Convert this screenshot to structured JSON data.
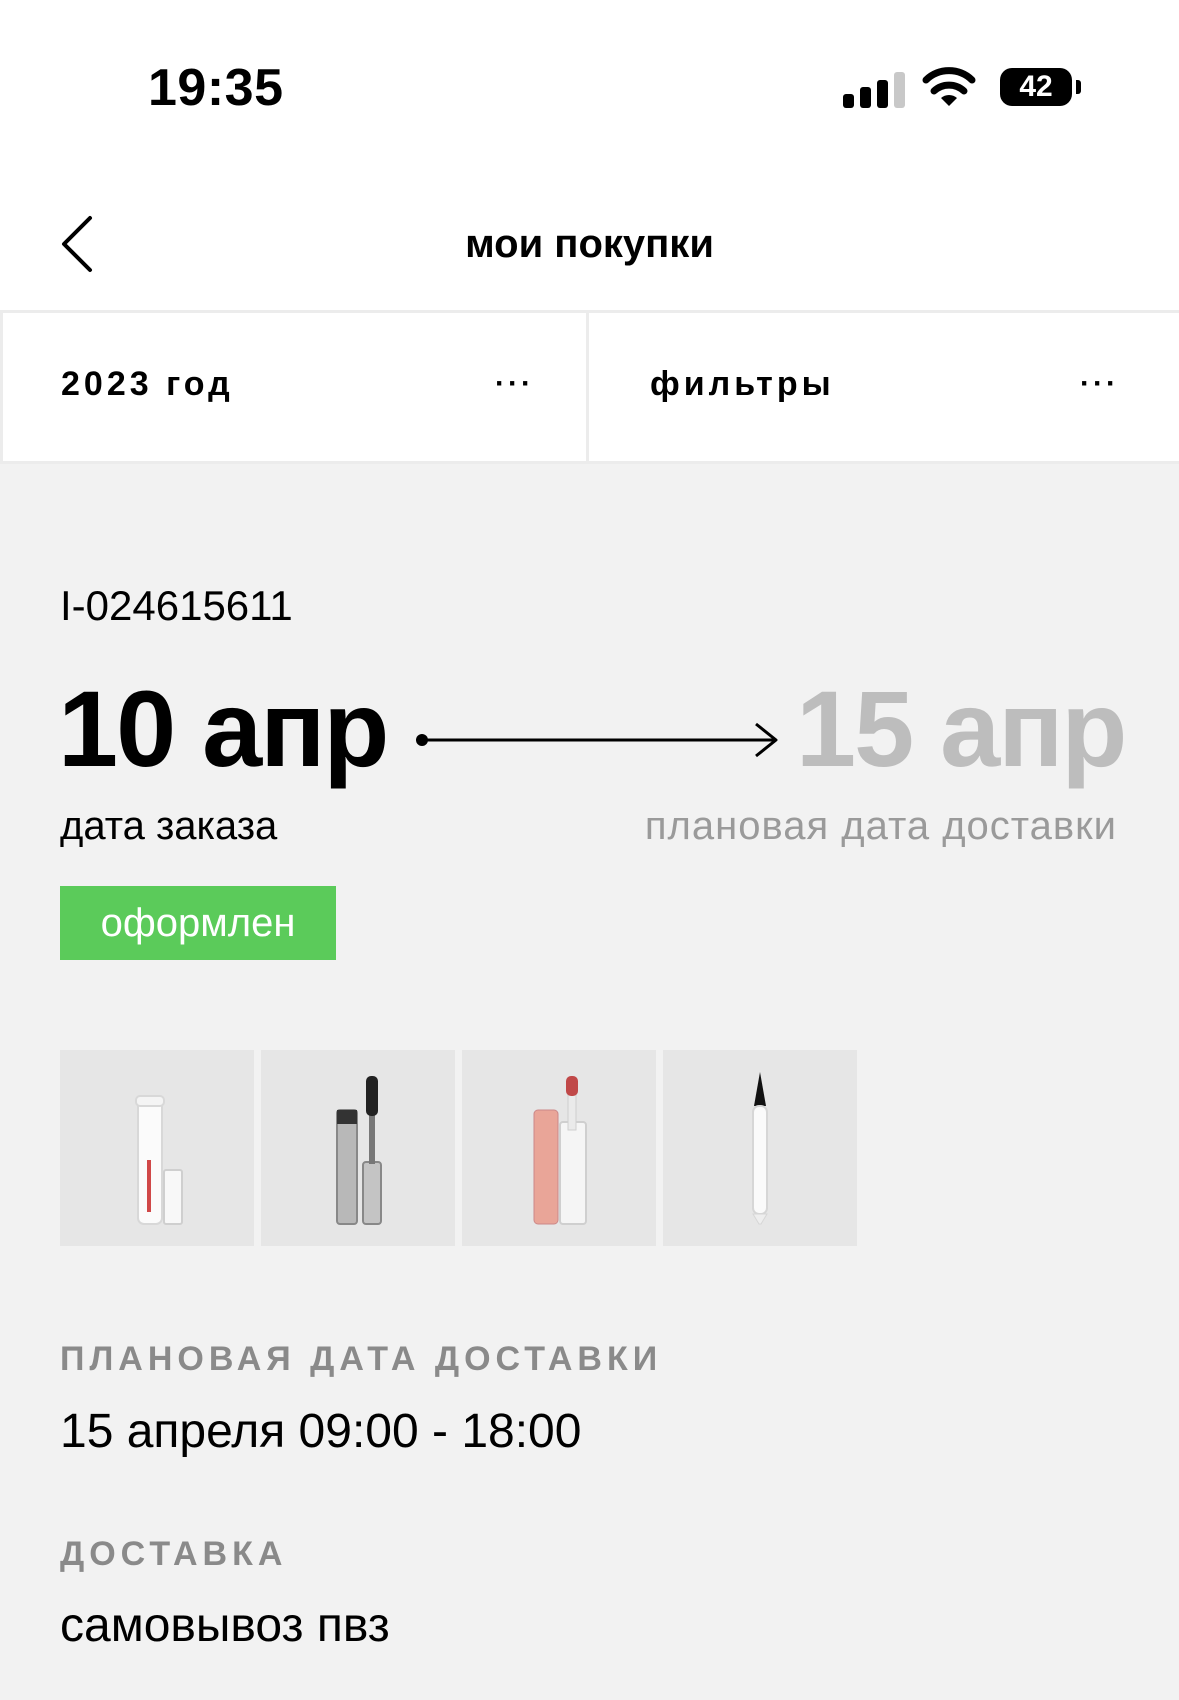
{
  "status_bar": {
    "time": "19:35",
    "battery": "42"
  },
  "header": {
    "title": "мои покупки",
    "back_icon": "chevron-left-icon"
  },
  "filters": {
    "year_label": "2023 год",
    "filters_label": "фильтры",
    "more_icon": "more-dots-icon",
    "dots": "···"
  },
  "order": {
    "id": "I-024615611",
    "order_date": "10 апр",
    "order_date_label": "дата заказа",
    "delivery_date": "15 апр",
    "delivery_date_label": "плановая дата доставки",
    "status": "оформлен",
    "status_color": "#5bcb5a"
  },
  "products": [
    {
      "name": "lip-softener-thumb"
    },
    {
      "name": "mascara-thumb"
    },
    {
      "name": "lip-tint-thumb"
    },
    {
      "name": "eyeliner-thumb"
    }
  ],
  "details": {
    "planned_delivery_title": "ПЛАНОВАЯ ДАТА ДОСТАВКИ",
    "planned_delivery_value": "15 апреля 09:00 - 18:00",
    "delivery_title": "ДОСТАВКА",
    "delivery_value": "самовывоз пвз"
  }
}
